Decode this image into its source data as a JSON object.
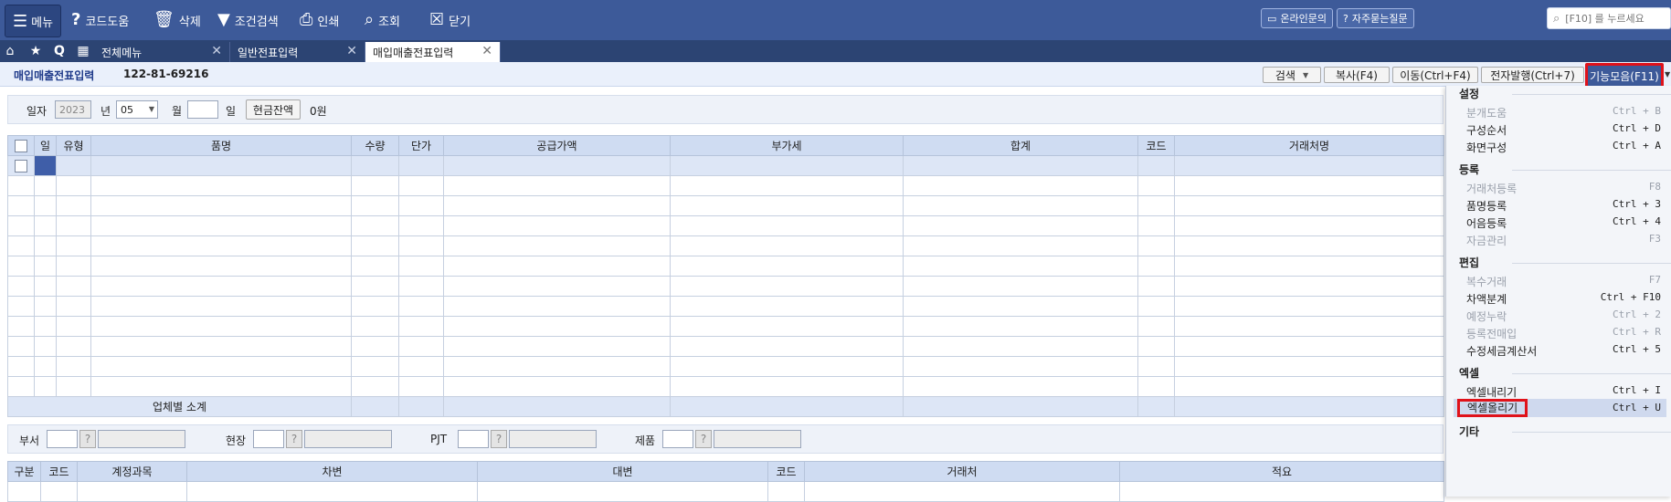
{
  "toolbar": {
    "menu": "메뉴",
    "items": [
      "코드도움",
      "삭제",
      "조건검색",
      "인쇄",
      "조회",
      "닫기"
    ],
    "online_inquiry": "온라인문의",
    "faq": "자주묻는질문",
    "search_placeholder": "[F10] 를 누르세요"
  },
  "tabs": [
    {
      "label": "전체메뉴",
      "active": false
    },
    {
      "label": "일반전표입력",
      "active": false
    },
    {
      "label": "매입매출전표입력",
      "active": true
    }
  ],
  "title": {
    "page": "매입매출전표입력",
    "biz_no": "122-81-69216"
  },
  "actions": {
    "search": "검색",
    "copy": "복사(F4)",
    "move": "이동(Ctrl+F4)",
    "e_issue": "전자발행(Ctrl+7)",
    "functions": "기능모음(F11)"
  },
  "filter": {
    "date_label": "일자",
    "year": "2023",
    "year_unit": "년",
    "month": "05",
    "month_unit": "월",
    "day": "",
    "day_unit": "일",
    "cash_btn": "현금잔액",
    "cash_value": "0원"
  },
  "grid": {
    "headers": [
      "일",
      "유형",
      "품명",
      "수량",
      "단가",
      "공급가액",
      "부가세",
      "합계",
      "코드",
      "거래처명"
    ],
    "subtotal_label": "업체별 소계"
  },
  "dept": {
    "labels": [
      "부서",
      "현장",
      "PJT",
      "제품"
    ]
  },
  "journal": {
    "headers": [
      "구분",
      "코드",
      "계정과목",
      "차변",
      "대변",
      "코드",
      "거래처",
      "적요"
    ]
  },
  "panel": {
    "sections": [
      {
        "title": "설정",
        "items": [
          {
            "label": "분개도움",
            "shortcut": "Ctrl + B",
            "enabled": false
          },
          {
            "label": "구성순서",
            "shortcut": "Ctrl + D",
            "enabled": true
          },
          {
            "label": "화면구성",
            "shortcut": "Ctrl + A",
            "enabled": true
          }
        ]
      },
      {
        "title": "등록",
        "items": [
          {
            "label": "거래처등록",
            "shortcut": "F8",
            "enabled": false
          },
          {
            "label": "품명등록",
            "shortcut": "Ctrl + 3",
            "enabled": true
          },
          {
            "label": "어음등록",
            "shortcut": "Ctrl + 4",
            "enabled": true
          },
          {
            "label": "자금관리",
            "shortcut": "F3",
            "enabled": false
          }
        ]
      },
      {
        "title": "편집",
        "items": [
          {
            "label": "복수거래",
            "shortcut": "F7",
            "enabled": false
          },
          {
            "label": "차액분계",
            "shortcut": "Ctrl + F10",
            "enabled": true
          },
          {
            "label": "예정누락",
            "shortcut": "Ctrl + 2",
            "enabled": false
          },
          {
            "label": "등록전매입",
            "shortcut": "Ctrl + R",
            "enabled": false
          },
          {
            "label": "수정세금계산서",
            "shortcut": "Ctrl + 5",
            "enabled": true
          }
        ]
      },
      {
        "title": "엑셀",
        "items": [
          {
            "label": "엑셀내리기",
            "shortcut": "Ctrl + I",
            "enabled": true
          },
          {
            "label": "엑셀올리기",
            "shortcut": "Ctrl + U",
            "enabled": true
          }
        ]
      },
      {
        "title": "기타",
        "items": []
      }
    ]
  }
}
